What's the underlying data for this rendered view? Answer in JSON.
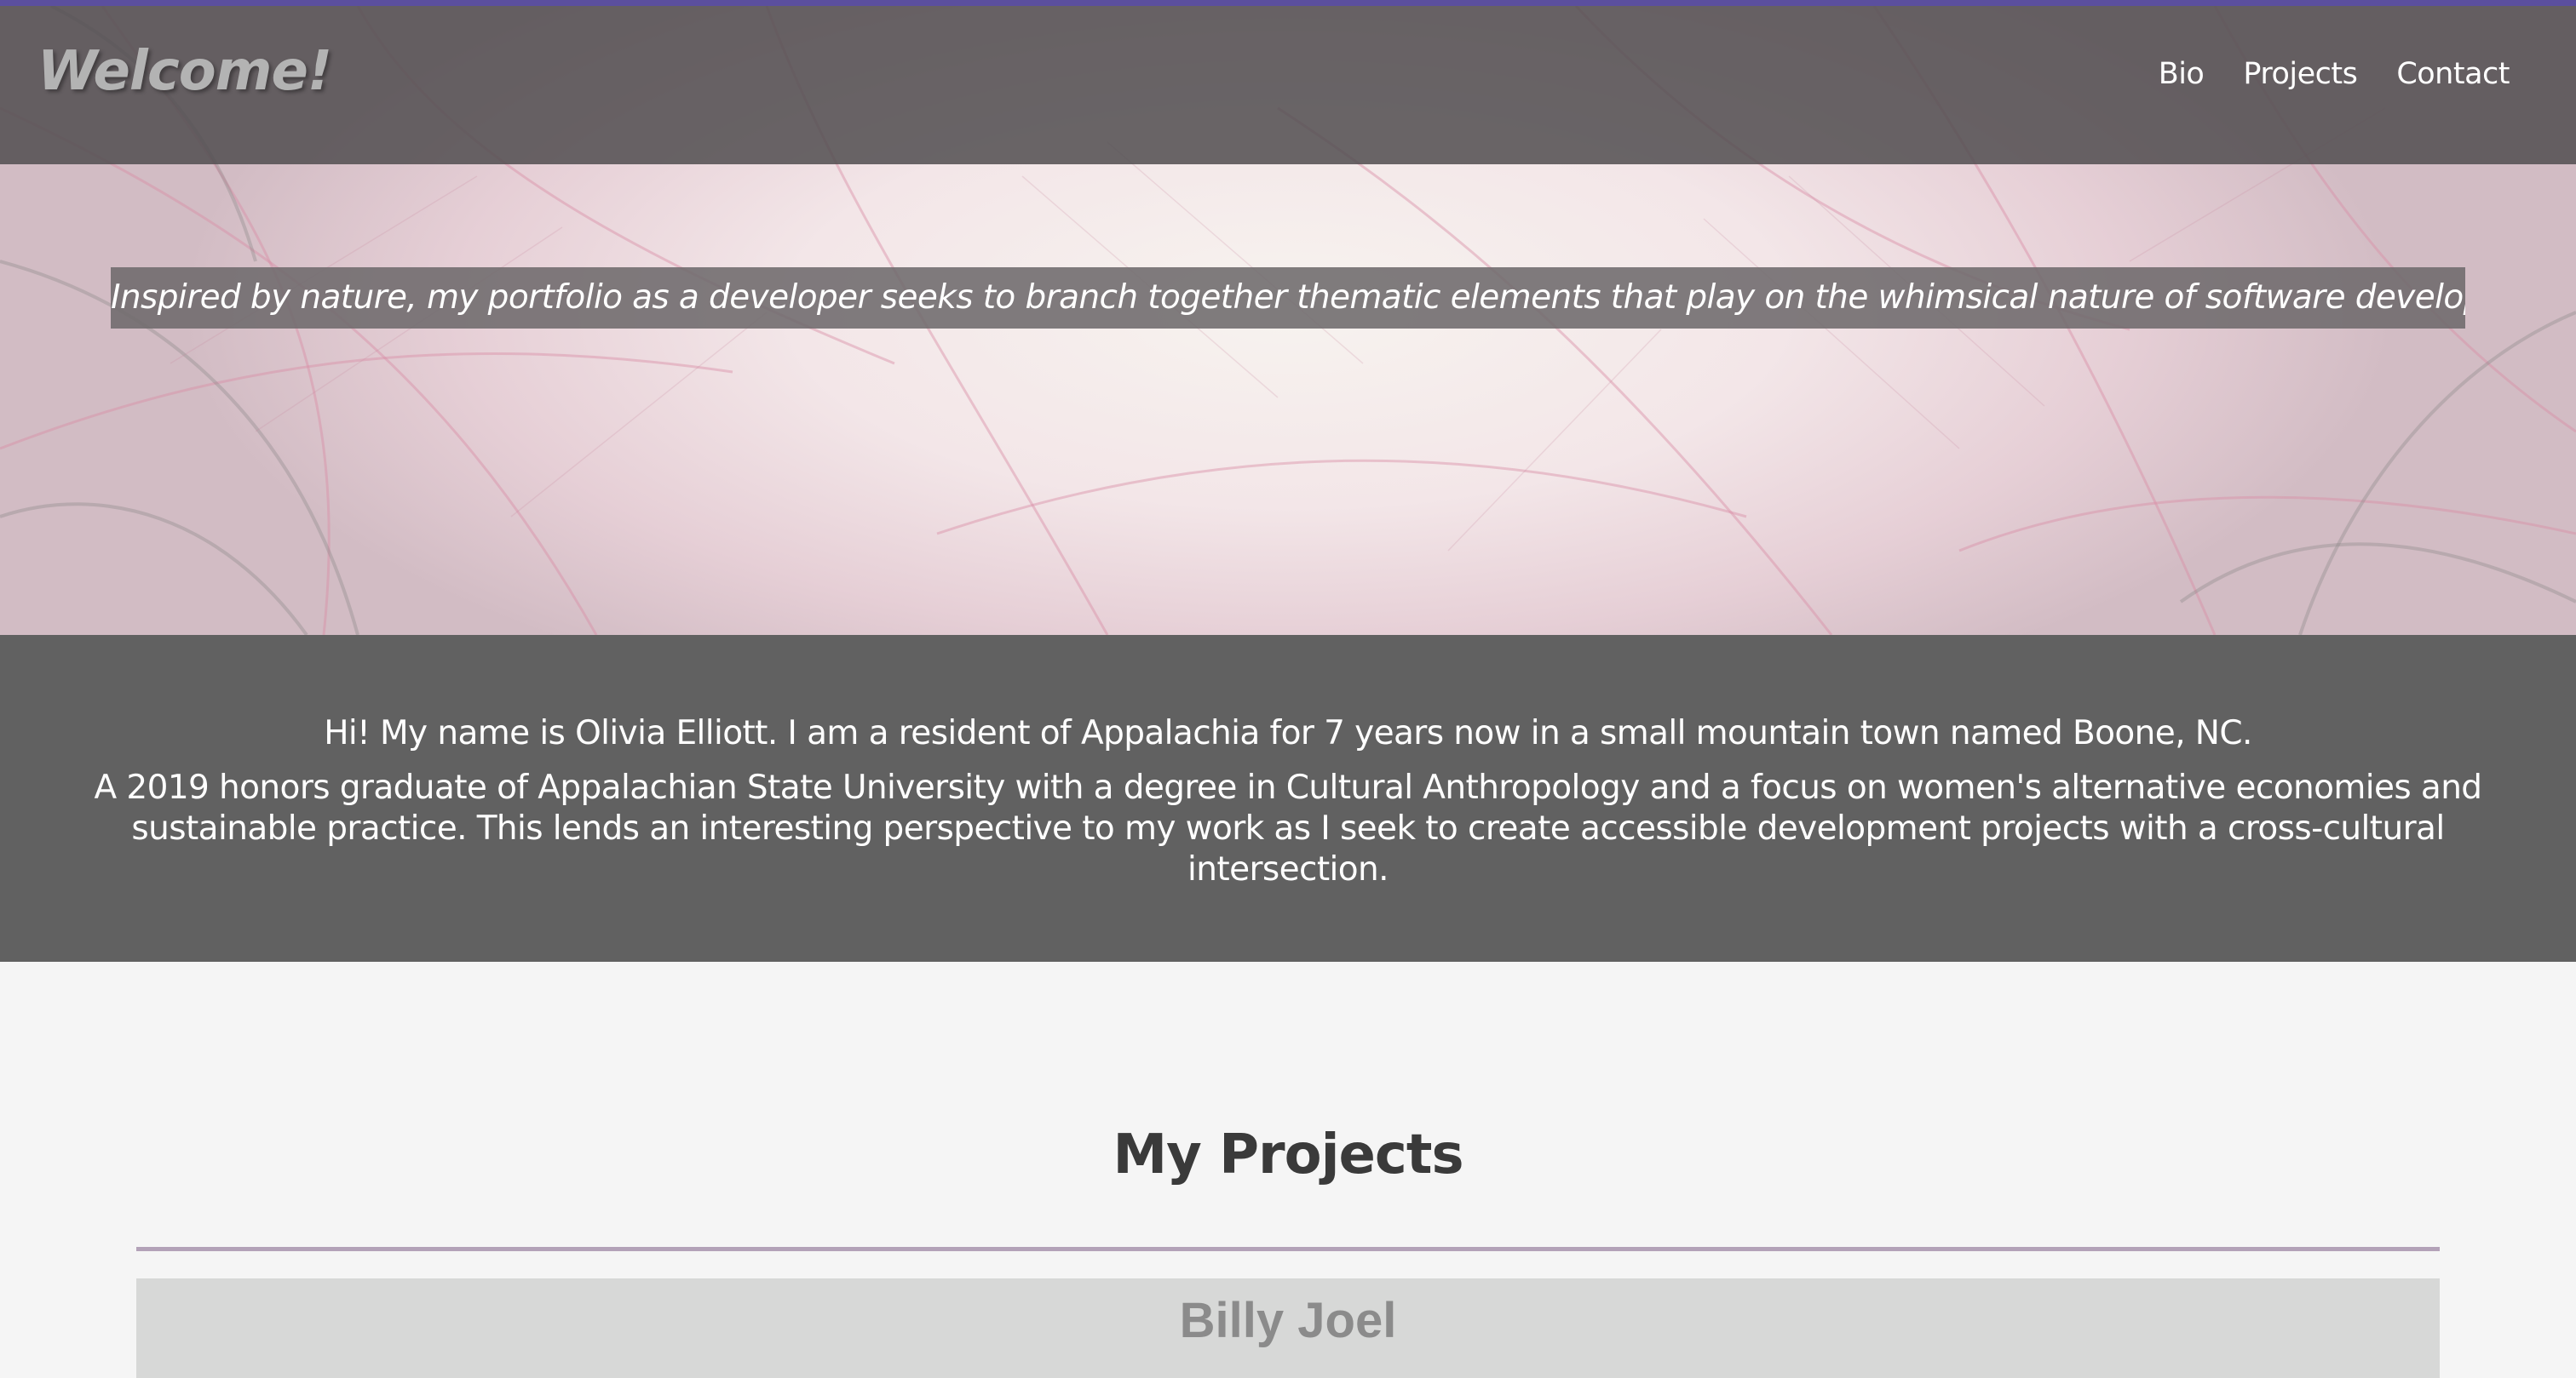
{
  "header": {
    "brand": "Welcome!",
    "nav": [
      {
        "label": "Bio"
      },
      {
        "label": "Projects"
      },
      {
        "label": "Contact"
      }
    ]
  },
  "hero": {
    "tagline": "Inspired by nature, my portfolio as a developer seeks to branch together thematic elements that play on the whimsical nature of software development."
  },
  "bio": {
    "line1": "Hi! My name is Olivia Elliott. I am a resident of Appalachia for 7 years now in a small mountain town named Boone, NC.",
    "line2": "A 2019 honors graduate of Appalachian State University with a degree in Cultural Anthropology and a focus on women's alternative economies and sustainable practice. This lends an interesting perspective to my work as I seek to create accessible development projects with a cross-cultural intersection."
  },
  "projects": {
    "title": "My Projects",
    "items": [
      {
        "title": "Billy Joel"
      }
    ]
  },
  "colors": {
    "accent": "#5b4f9e",
    "header_bg": "#524e50",
    "bio_bg": "#616161",
    "rule": "#b3a2b8",
    "card_bg": "#d7d8d7"
  }
}
